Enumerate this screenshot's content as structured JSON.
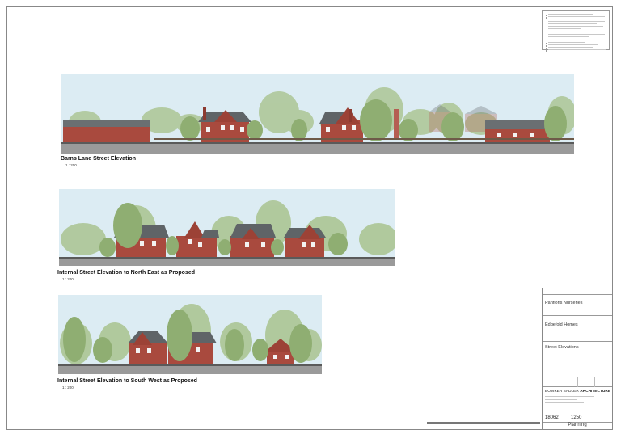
{
  "notes": {
    "line_count_group1": 7,
    "line_count_group2": 4
  },
  "elevations": [
    {
      "id": "barns-lane",
      "caption": "Barns Lane Street Elevation",
      "scale": "1 : 200"
    },
    {
      "id": "north-east",
      "caption": "Internal Street Elevation to North East as Proposed",
      "scale": "1 : 200"
    },
    {
      "id": "south-west",
      "caption": "Internal Street Elevation to South West as Proposed",
      "scale": "1 : 200"
    }
  ],
  "title_block": {
    "project": "Panfloris Nurseries",
    "client": "Edgefold Homes",
    "drawing_title": "Street Elevations",
    "firm_name_light": "BOWKER SADLER ",
    "firm_name_bold": "ARCHITECTURE",
    "project_number": "18062",
    "drawing_number": "1250",
    "status": "Planning"
  },
  "colors": {
    "sky": "#dcecf3",
    "brick": "#a94a3e",
    "roof": "#5f6467",
    "tree": "#8fae72",
    "ground": "#9a9a9a"
  }
}
